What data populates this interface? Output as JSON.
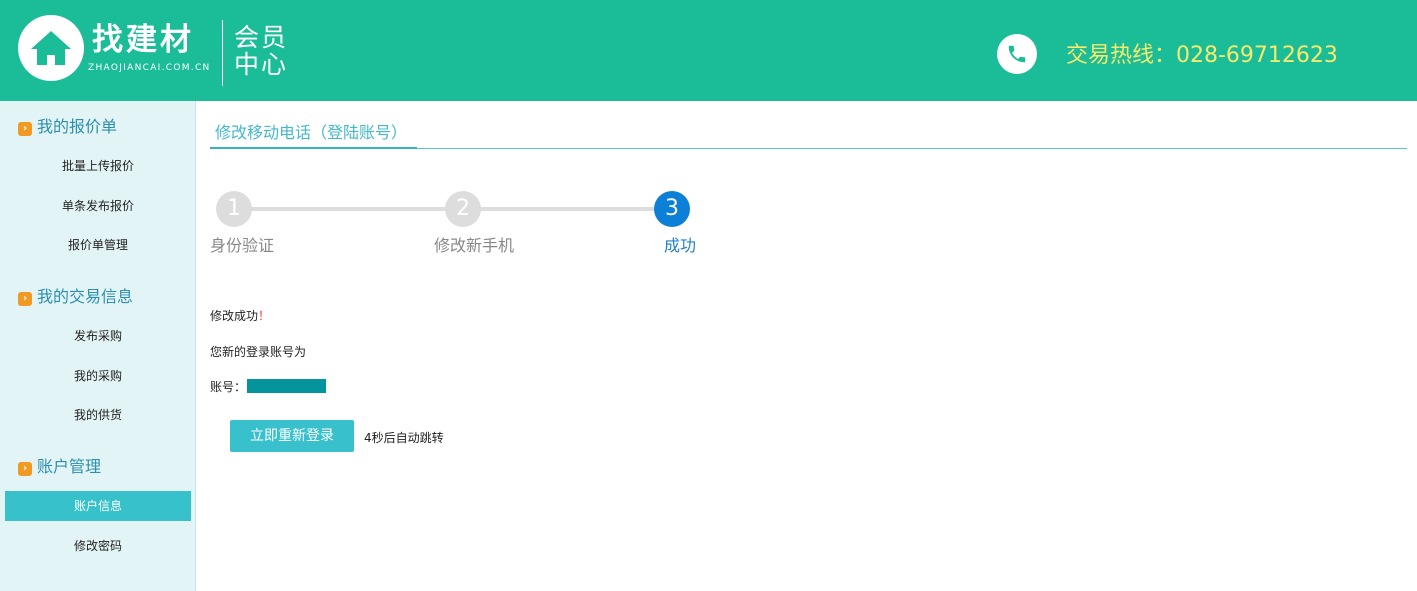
{
  "header": {
    "brand_name": "找建材",
    "brand_domain": "ZHAOJIANCAI.COM.CN",
    "member_center": "会员中心",
    "hotline": "交易热线：028-69712623",
    "colors": {
      "bg": "#1bbd98",
      "hotline": "#f7eb6b"
    }
  },
  "sidebar": {
    "groups": [
      {
        "title": "我的报价单",
        "items": [
          {
            "label": "批量上传报价"
          },
          {
            "label": "单条发布报价"
          },
          {
            "label": "报价单管理"
          }
        ]
      },
      {
        "title": "我的交易信息",
        "items": [
          {
            "label": "发布采购"
          },
          {
            "label": "我的采购"
          },
          {
            "label": "我的供货"
          }
        ]
      },
      {
        "title": "账户管理",
        "items": [
          {
            "label": "账户信息",
            "active": true
          },
          {
            "label": "修改密码"
          }
        ]
      }
    ]
  },
  "main": {
    "section_title": "修改移动电话（登陆账号）",
    "steps": [
      {
        "number": "1",
        "label": "身份验证"
      },
      {
        "number": "2",
        "label": "修改新手机"
      },
      {
        "number": "3",
        "label": "成功",
        "current": true
      }
    ],
    "success_text": "修改成功",
    "success_mark": "！",
    "new_account_text": "您新的登录账号为",
    "account_label": "账号：",
    "relogin_button": "立即重新登录",
    "countdown_text": "4秒后自动跳转"
  }
}
